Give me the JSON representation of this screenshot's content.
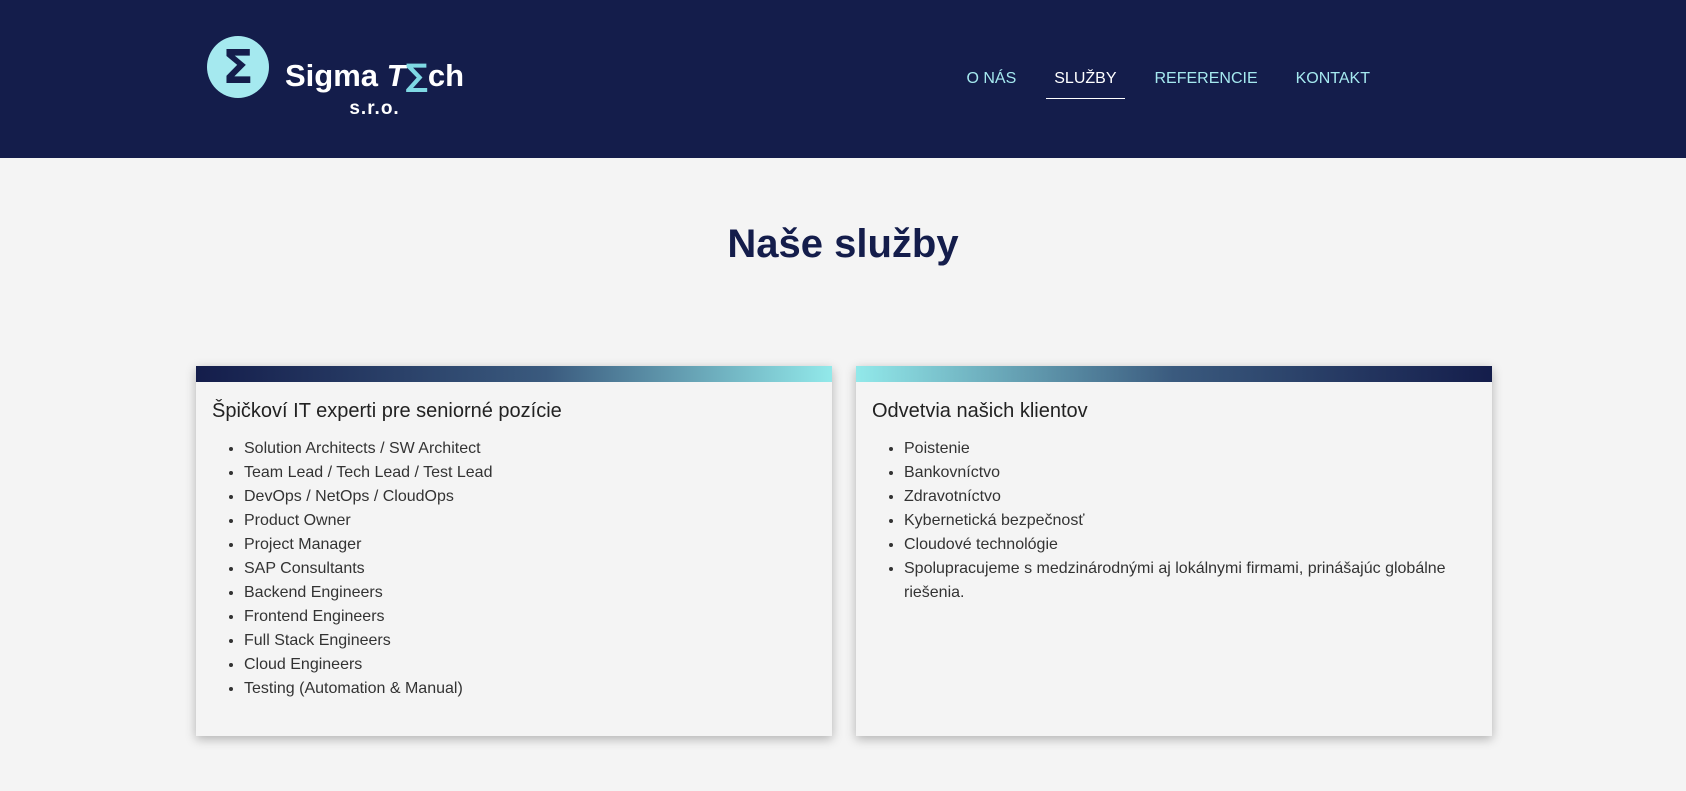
{
  "brand": {
    "logo_glyph": "Σ",
    "name_part1": "Sigma ",
    "name_part2": "T",
    "name_sigma": "∑",
    "name_part3": "ch",
    "subtitle": "s.r.o.",
    "colors": {
      "header_bg": "#141d4b",
      "accent": "#a5e9ef"
    }
  },
  "nav": {
    "items": [
      {
        "label": "O NÁS",
        "active": false
      },
      {
        "label": "SLUŽBY",
        "active": true
      },
      {
        "label": "REFERENCIE",
        "active": false
      },
      {
        "label": "KONTAKT",
        "active": false
      }
    ]
  },
  "page": {
    "title": "Naše služby"
  },
  "cards": [
    {
      "title": "Špičkoví IT experti pre seniorné pozície",
      "items": [
        "Solution Architects / SW Architect",
        "Team Lead / Tech Lead / Test Lead",
        "DevOps / NetOps / CloudOps",
        "Product Owner",
        "Project Manager",
        "SAP Consultants",
        "Backend Engineers",
        "Frontend Engineers",
        "Full Stack Engineers",
        "Cloud Engineers",
        "Testing (Automation & Manual)"
      ]
    },
    {
      "title": "Odvetvia našich klientov",
      "items": [
        "Poistenie",
        "Bankovníctvo",
        "Zdravotníctvo",
        "Kybernetická bezpečnosť",
        "Cloudové technológie",
        "Spolupracujeme s medzinárodnými aj lokálnymi firmami, prinášajúc globálne riešenia."
      ]
    }
  ]
}
